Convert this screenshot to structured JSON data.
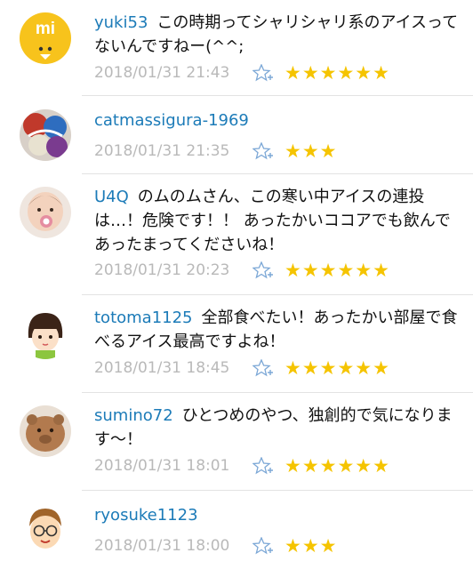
{
  "colors": {
    "username": "#1c7bb8",
    "timestamp": "#b9b9b9",
    "star": "#f5c400"
  },
  "comments": [
    {
      "user": "yuki53",
      "text": "この時期ってシャリシャリ系のアイスってないんですねー(^^;",
      "time": "2018/01/31 21:43",
      "stars": "★★★★★★",
      "star_count": 6,
      "avatar_icon": "mi-logo-icon"
    },
    {
      "user": "catmassigura-1969",
      "text": "",
      "time": "2018/01/31 21:35",
      "stars": "★★★",
      "star_count": 3,
      "avatar_icon": "colorful-photo-avatar-icon"
    },
    {
      "user": "U4Q",
      "text": "のムのムさん、この寒い中アイスの連投は…！危険です！！ あったかいココアでも飲んであったまってくださいね！",
      "time": "2018/01/31 20:23",
      "stars": "★★★★★★",
      "star_count": 6,
      "avatar_icon": "baby-photo-avatar-icon"
    },
    {
      "user": "totoma1125",
      "text": "全部食べたい！あったかい部屋で食べるアイス最高ですよね！",
      "time": "2018/01/31 18:45",
      "stars": "★★★★★★",
      "star_count": 6,
      "avatar_icon": "girl-illustration-avatar-icon"
    },
    {
      "user": "sumino72",
      "text": "ひとつめのやつ、独創的で気になります〜！",
      "time": "2018/01/31 18:01",
      "stars": "★★★★★★",
      "star_count": 6,
      "avatar_icon": "capybara-photo-avatar-icon"
    },
    {
      "user": "ryosuke1123",
      "text": "",
      "time": "2018/01/31 18:00",
      "stars": "★★★",
      "star_count": 3,
      "avatar_icon": "boy-glasses-avatar-icon"
    }
  ]
}
